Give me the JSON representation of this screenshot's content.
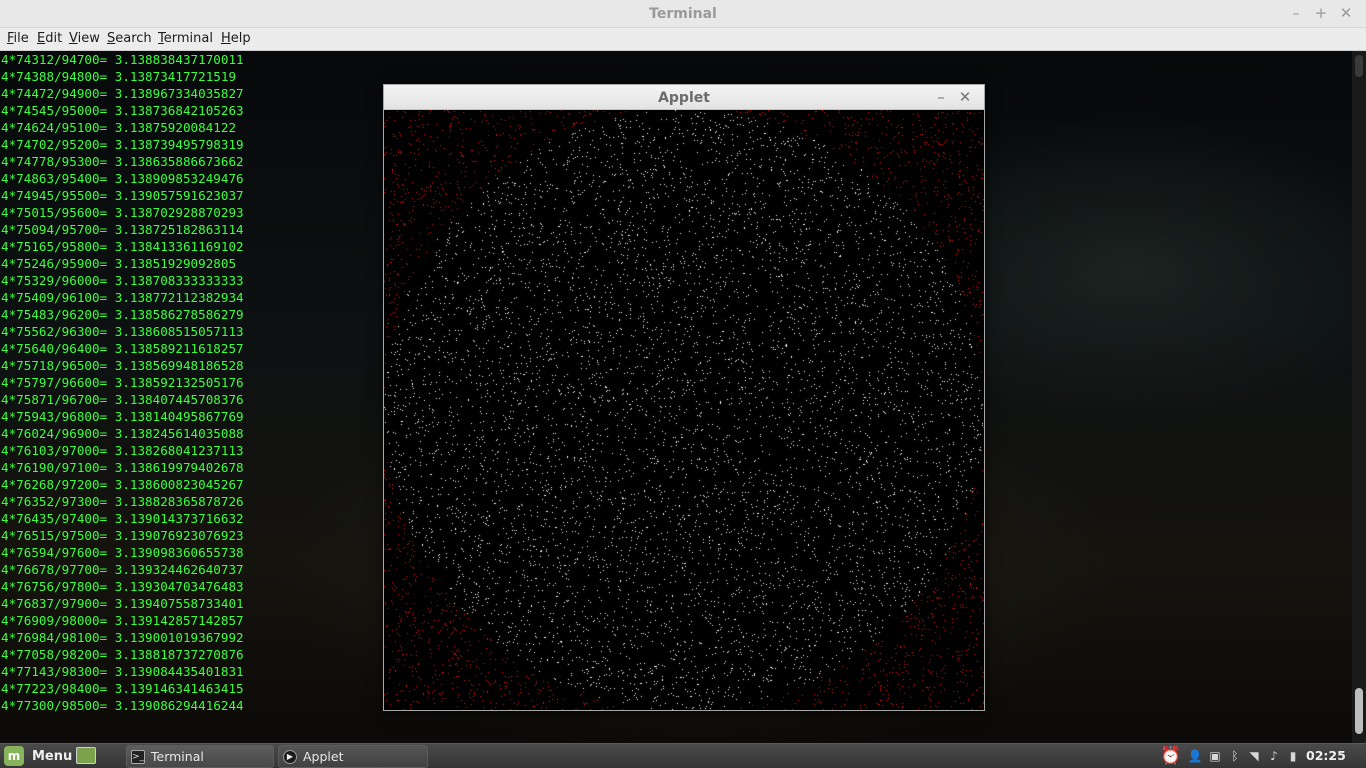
{
  "terminal": {
    "title": "Terminal",
    "menu": [
      {
        "label": "File",
        "mnemonic": "F",
        "rest": "ile"
      },
      {
        "label": "Edit",
        "mnemonic": "E",
        "rest": "dit"
      },
      {
        "label": "View",
        "mnemonic": "V",
        "rest": "iew"
      },
      {
        "label": "Search",
        "mnemonic": "S",
        "rest": "earch"
      },
      {
        "label": "Terminal",
        "mnemonic": "T",
        "rest": "erminal"
      },
      {
        "label": "Help",
        "mnemonic": "H",
        "rest": "elp"
      }
    ],
    "window_controls": {
      "minimize": "–",
      "maximize": "+",
      "close": "✕"
    },
    "text_color": "#3cff3c",
    "lines": [
      "4*74312/94700= 3.138838437170011",
      "4*74388/94800= 3.13873417721519",
      "4*74472/94900= 3.138967334035827",
      "4*74545/95000= 3.138736842105263",
      "4*74624/95100= 3.13875920084122",
      "4*74702/95200= 3.138739495798319",
      "4*74778/95300= 3.138635886673662",
      "4*74863/95400= 3.138909853249476",
      "4*74945/95500= 3.139057591623037",
      "4*75015/95600= 3.138702928870293",
      "4*75094/95700= 3.138725182863114",
      "4*75165/95800= 3.138413361169102",
      "4*75246/95900= 3.13851929092805",
      "4*75329/96000= 3.138708333333333",
      "4*75409/96100= 3.138772112382934",
      "4*75483/96200= 3.138586278586279",
      "4*75562/96300= 3.138608515057113",
      "4*75640/96400= 3.138589211618257",
      "4*75718/96500= 3.138569948186528",
      "4*75797/96600= 3.138592132505176",
      "4*75871/96700= 3.138407445708376",
      "4*75943/96800= 3.138140495867769",
      "4*76024/96900= 3.138245614035088",
      "4*76103/97000= 3.138268041237113",
      "4*76190/97100= 3.138619979402678",
      "4*76268/97200= 3.138600823045267",
      "4*76352/97300= 3.138828365878726",
      "4*76435/97400= 3.139014373716632",
      "4*76515/97500= 3.139076923076923",
      "4*76594/97600= 3.139098360655738",
      "4*76678/97700= 3.139324462640737",
      "4*76756/97800= 3.139304703476483",
      "4*76837/97900= 3.139407558733401",
      "4*76909/98000= 3.139142857142857",
      "4*76984/98100= 3.139001019367992",
      "4*77058/98200= 3.138818737270876",
      "4*77143/98300= 3.139084435401831",
      "4*77223/98400= 3.139146341463415",
      "4*77300/98500= 3.139086294416244"
    ]
  },
  "applet": {
    "title": "Applet",
    "window_controls": {
      "minimize": "–",
      "close": "✕"
    },
    "colors": {
      "outside": "#e01818",
      "inside": "#ffffff",
      "background": "#000000"
    }
  },
  "taskbar": {
    "menu_label": "Menu",
    "tasks": [
      {
        "label": "Terminal",
        "icon": "terminal-icon"
      },
      {
        "label": "Applet",
        "icon": "applet-icon"
      }
    ],
    "tray_icons": [
      "alarm-clock-icon",
      "user-icon",
      "removable-drive-icon",
      "bluetooth-icon",
      "wifi-icon",
      "volume-icon",
      "battery-icon"
    ],
    "clock": "02:25"
  }
}
